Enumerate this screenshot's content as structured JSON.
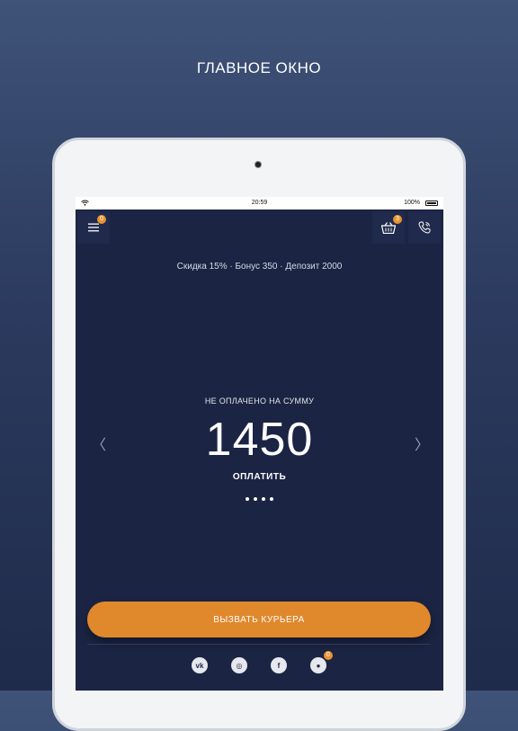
{
  "headline": "ГЛАВНОЕ ОКНО",
  "status_bar": {
    "time": "20:59",
    "battery": "100%"
  },
  "top_bar": {
    "menu_badge": "0",
    "cart_badge": "3"
  },
  "info_line": "Скидка 15% · Бонус 350 · Депозит 2000",
  "payment": {
    "label": "НЕ ОПЛАЧЕНО НА СУММУ",
    "amount": "1450",
    "pay_label": "ОПЛАТИТЬ",
    "prev_arrow": "〈",
    "next_arrow": "〉"
  },
  "call_courier_label": "ВЫЗВАТЬ КУРЬЕРА",
  "social": [
    {
      "icon": "vk-icon",
      "glyph": "vk"
    },
    {
      "icon": "instagram-icon",
      "glyph": "◎"
    },
    {
      "icon": "facebook-icon",
      "glyph": "f"
    },
    {
      "icon": "chat-icon",
      "glyph": "●"
    }
  ],
  "chat_badge": "0",
  "colors": {
    "accent": "#e0882c",
    "screen_bg": "#1b2443",
    "badge": "#e8922e"
  }
}
